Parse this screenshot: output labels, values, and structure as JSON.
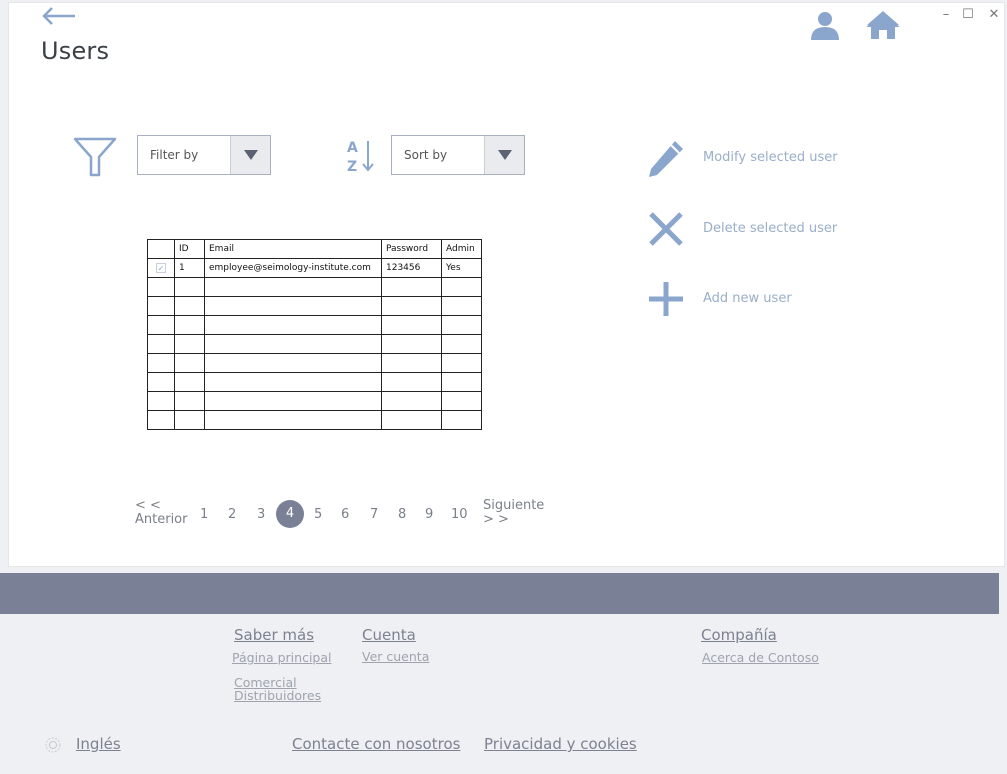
{
  "header": {
    "title": "Users",
    "window_controls": {
      "minimize": "–",
      "maximize": "☐",
      "close": "✕"
    }
  },
  "filters": {
    "filter_label": "Filter by",
    "sort_label": "Sort by"
  },
  "actions": {
    "modify": "Modify selected user",
    "delete": "Delete selected user",
    "add": "Add new user"
  },
  "table": {
    "columns": [
      "",
      "ID",
      "Email",
      "Password",
      "Admin"
    ],
    "rows": [
      {
        "checked": "✓",
        "id": "1",
        "email": "employee@seimology-institute.com",
        "password": "123456",
        "admin": "Yes"
      }
    ],
    "empty_rows": 8
  },
  "pagination": {
    "prev_symbol": "< <",
    "prev_label": "Anterior",
    "pages": [
      "1",
      "2",
      "3",
      "4",
      "5",
      "6",
      "7",
      "8",
      "9",
      "10"
    ],
    "current": "4",
    "next_label": "Siguiente",
    "next_symbol": "> >"
  },
  "footer": {
    "saber_mas": "Saber más",
    "pagina_principal": "Página principal",
    "comercial": "Comercial",
    "distribuidores": "Distribuidores",
    "cuenta": "Cuenta",
    "ver_cuenta": "Ver cuenta",
    "compania": "Compañía",
    "acerca": "Acerca de Contoso",
    "language": "Inglés",
    "contacto": "Contacte con nosotros",
    "privacidad": "Privacidad y cookies"
  },
  "colors": {
    "accent": "#9aaec8",
    "icon": "#8aa6cc",
    "band": "#7a8196",
    "active_page": "#7a8196"
  },
  "icons": [
    "back-arrow-icon",
    "user-icon",
    "home-icon",
    "funnel-icon",
    "sort-az-icon",
    "chevron-down-icon",
    "pencil-icon",
    "x-icon",
    "plus-icon",
    "globe-icon"
  ]
}
